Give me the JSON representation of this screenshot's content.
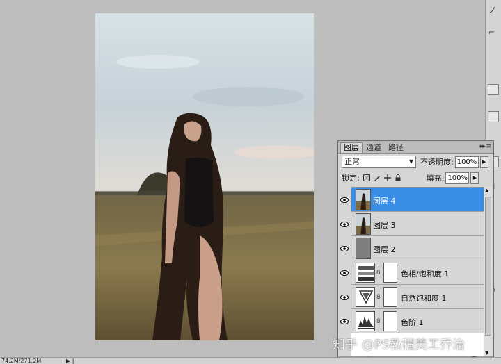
{
  "layers_panel": {
    "tabs": [
      {
        "label": "图层",
        "active": true
      },
      {
        "label": "通道",
        "active": false
      },
      {
        "label": "路径",
        "active": false
      }
    ],
    "blend_mode": "正常",
    "opacity_label": "不透明度:",
    "opacity_value": "100%",
    "lock_label": "锁定:",
    "fill_label": "填充:",
    "fill_value": "100%",
    "layers": [
      {
        "name": "图层 4",
        "type": "photo",
        "selected": true
      },
      {
        "name": "图层 3",
        "type": "photo",
        "selected": false
      },
      {
        "name": "图层 2",
        "type": "gray",
        "selected": false
      },
      {
        "name": "色相/饱和度 1",
        "type": "hue-saturation",
        "selected": false
      },
      {
        "name": "自然饱和度 1",
        "type": "vibrance",
        "selected": false
      },
      {
        "name": "色阶 1",
        "type": "levels",
        "selected": false
      }
    ]
  },
  "status_bar": {
    "doc_size": "74.2M/271.2M"
  },
  "watermark": "知乎 @PS教程美工乔治"
}
